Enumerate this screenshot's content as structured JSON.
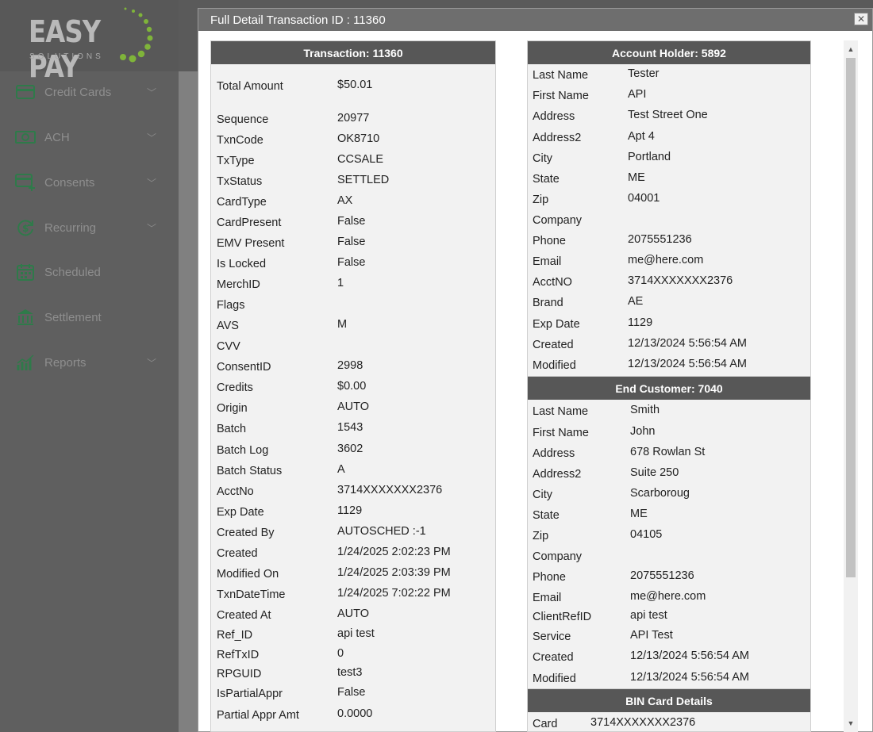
{
  "brand": {
    "name": "EASY PAY",
    "tagline": "SOLUTIONS"
  },
  "sidebar": {
    "items": [
      {
        "label": "Credit Cards",
        "icon": "credit-card-icon",
        "chevron": true
      },
      {
        "label": "ACH",
        "icon": "cash-icon",
        "chevron": true
      },
      {
        "label": "Consents",
        "icon": "card-plus-icon",
        "chevron": true
      },
      {
        "label": "Recurring",
        "icon": "recurring-dollar-icon",
        "chevron": true
      },
      {
        "label": "Scheduled",
        "icon": "calendar-icon",
        "chevron": false
      },
      {
        "label": "Settlement",
        "icon": "bank-icon",
        "chevron": false
      },
      {
        "label": "Reports",
        "icon": "chart-icon",
        "chevron": true
      }
    ]
  },
  "modal": {
    "title": "Full Detail Transaction ID : 11360",
    "close_label": "✕"
  },
  "transaction": {
    "title": "Transaction: 11360",
    "rows": [
      {
        "label": "Total Amount",
        "value": "$50.01"
      },
      {
        "label": "Sequence",
        "value": "20977"
      },
      {
        "label": "TxnCode",
        "value": "OK8710"
      },
      {
        "label": "TxType",
        "value": "CCSALE"
      },
      {
        "label": "TxStatus",
        "value": "SETTLED"
      },
      {
        "label": "CardType",
        "value": "AX"
      },
      {
        "label": "CardPresent",
        "value": "False"
      },
      {
        "label": "EMV Present",
        "value": "False"
      },
      {
        "label": "Is Locked",
        "value": "False"
      },
      {
        "label": "MerchID",
        "value": "1"
      },
      {
        "label": "Flags",
        "value": ""
      },
      {
        "label": "AVS",
        "value": "M"
      },
      {
        "label": "CVV",
        "value": ""
      },
      {
        "label": "ConsentID",
        "value": "2998"
      },
      {
        "label": "Credits",
        "value": "$0.00"
      },
      {
        "label": "Origin",
        "value": "AUTO"
      },
      {
        "label": "Batch",
        "value": "1543"
      },
      {
        "label": "Batch Log",
        "value": "3602"
      },
      {
        "label": "Batch Status",
        "value": "A"
      },
      {
        "label": "AcctNo",
        "value": "3714XXXXXXX2376"
      },
      {
        "label": "Exp Date",
        "value": "1129"
      },
      {
        "label": "Created By",
        "value": "AUTOSCHED :-1"
      },
      {
        "label": "Created",
        "value": "1/24/2025 2:02:23 PM"
      },
      {
        "label": "Modified On",
        "value": "1/24/2025 2:03:39 PM"
      },
      {
        "label": "TxnDateTime",
        "value": "1/24/2025 7:02:22 PM"
      },
      {
        "label": "Created At",
        "value": "AUTO"
      },
      {
        "label": "Ref_ID",
        "value": "api test"
      },
      {
        "label": "RefTxID",
        "value": "0"
      },
      {
        "label": "RPGUID",
        "value": "test3"
      },
      {
        "label": "IsPartialAppr",
        "value": "False"
      },
      {
        "label": "Partial Appr Amt",
        "value": "0.0000"
      }
    ]
  },
  "account_holder": {
    "title": "Account Holder: 5892",
    "rows": [
      {
        "label": "Last Name",
        "value": "Tester"
      },
      {
        "label": "First Name",
        "value": "API"
      },
      {
        "label": "Address",
        "value": "Test Street One"
      },
      {
        "label": "Address2",
        "value": "Apt 4"
      },
      {
        "label": "City",
        "value": "Portland"
      },
      {
        "label": "State",
        "value": "ME"
      },
      {
        "label": "Zip",
        "value": "04001"
      },
      {
        "label": "Company",
        "value": ""
      },
      {
        "label": "Phone",
        "value": "2075551236"
      },
      {
        "label": "Email",
        "value": "me@here.com"
      },
      {
        "label": "AcctNO",
        "value": "3714XXXXXXX2376"
      },
      {
        "label": "Brand",
        "value": "AE"
      },
      {
        "label": "Exp Date",
        "value": "1129"
      },
      {
        "label": "Created",
        "value": "12/13/2024 5:56:54 AM"
      },
      {
        "label": "Modified",
        "value": "12/13/2024 5:56:54 AM"
      }
    ]
  },
  "end_customer": {
    "title": "End Customer: 7040",
    "rows": [
      {
        "label": "Last Name",
        "value": "Smith"
      },
      {
        "label": "First Name",
        "value": "John"
      },
      {
        "label": "Address",
        "value": "678 Rowlan St"
      },
      {
        "label": "Address2",
        "value": "Suite 250"
      },
      {
        "label": "City",
        "value": "Scarboroug"
      },
      {
        "label": "State",
        "value": "ME"
      },
      {
        "label": "Zip",
        "value": "04105"
      },
      {
        "label": "Company",
        "value": ""
      },
      {
        "label": "Phone",
        "value": "2075551236"
      },
      {
        "label": "Email",
        "value": "me@here.com"
      },
      {
        "label": "ClientRefID",
        "value": "api test"
      },
      {
        "label": "Service",
        "value": "API Test"
      },
      {
        "label": "Created",
        "value": "12/13/2024 5:56:54 AM"
      },
      {
        "label": "Modified",
        "value": "12/13/2024 5:56:54 AM"
      }
    ]
  },
  "bin_card": {
    "title": "BIN Card Details",
    "rows": [
      {
        "label": "Card",
        "value": "3714XXXXXXX2376"
      }
    ]
  },
  "colors": {
    "panel_header": "#575757",
    "sidebar_bg": "#5f5f5f",
    "logo_green": "#7fb43a"
  }
}
